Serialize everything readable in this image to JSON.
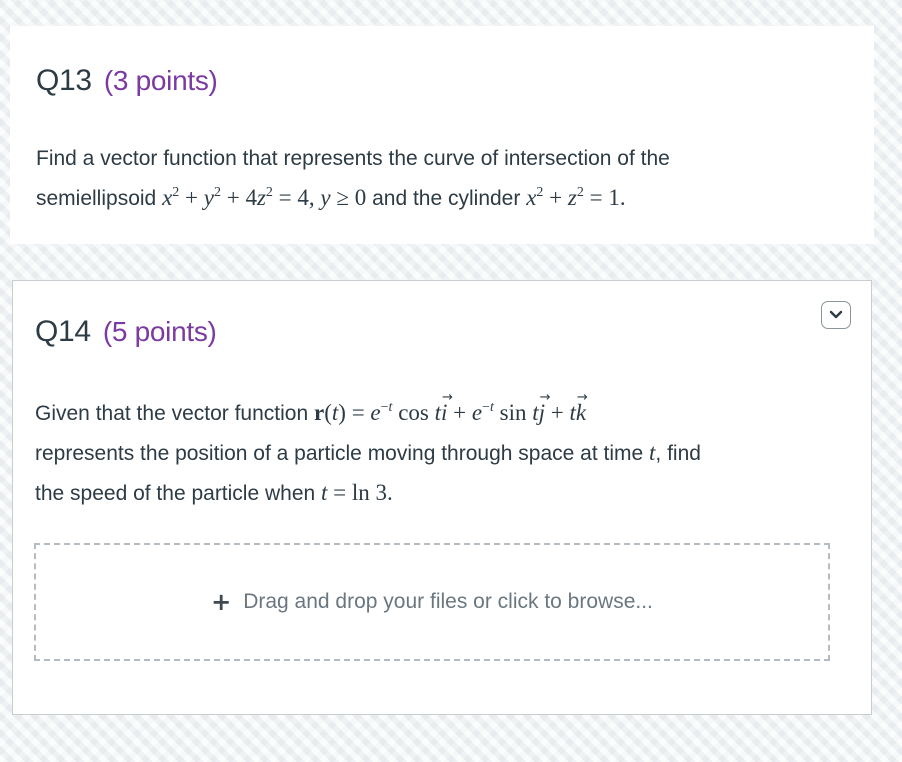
{
  "colors": {
    "points_purple": "#7b3aa2",
    "text": "#2d3b45",
    "dropzone_text": "#6b7780"
  },
  "q13": {
    "title": "Q13",
    "points": "(3 points)",
    "line1": "Find a vector function that represents the curve of intersection of the",
    "line2_prefix": "semiellipsoid ",
    "eq1": "x² + y² + 4z² = 4, y ≥ 0",
    "line2_mid": " and the cylinder ",
    "eq2": "x² + z² = 1."
  },
  "q14": {
    "title": "Q14",
    "points": "(5 points)",
    "collapse_icon": "chevron-down-icon",
    "line1_prefix": "Given that the vector function ",
    "equation": "r(t) = e^(−t) cos t i + e^(−t) sin t j + t k",
    "line2": "represents the position of a particle moving through space at time ",
    "time_var": "t",
    "line2_suffix": ", find",
    "line3_prefix": "the speed of the particle when ",
    "condition": "t = ln 3.",
    "dropzone": {
      "icon": "plus-icon",
      "label": "Drag and drop your files or click to browse..."
    }
  }
}
